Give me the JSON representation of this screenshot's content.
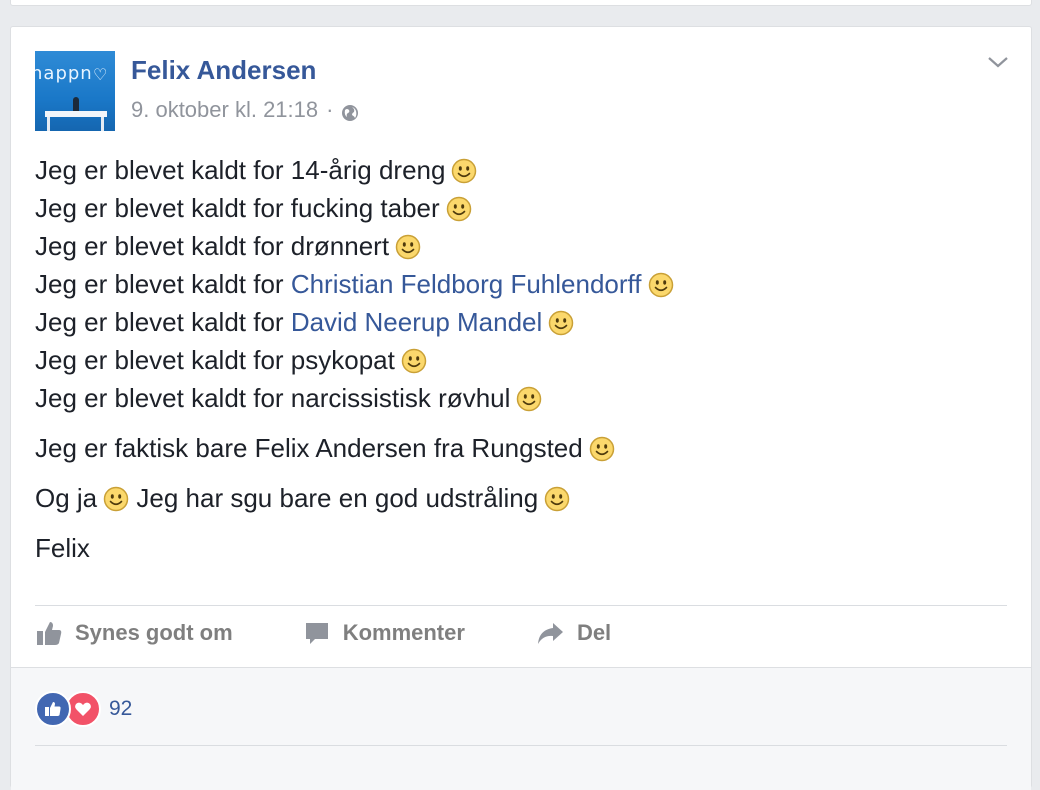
{
  "post": {
    "author": "Felix Andersen",
    "timestamp": "9. oktober kl. 21:18",
    "separator": "·",
    "privacy_icon": "globe-icon",
    "avatar_text": "happn",
    "lines": [
      {
        "prefix": "Jeg er blevet kaldt for 14-årig dreng",
        "link": ""
      },
      {
        "prefix": "Jeg er blevet kaldt for fucking taber",
        "link": ""
      },
      {
        "prefix": "Jeg er blevet kaldt for drønnert",
        "link": ""
      },
      {
        "prefix": "Jeg er blevet kaldt for ",
        "link": "Christian Feldborg Fuhlendorff"
      },
      {
        "prefix": "Jeg er blevet kaldt for ",
        "link": "David Neerup Mandel"
      },
      {
        "prefix": "Jeg er blevet kaldt for psykopat",
        "link": ""
      },
      {
        "prefix": "Jeg er blevet kaldt for narcissistisk røvhul",
        "link": ""
      }
    ],
    "para2": "Jeg er faktisk bare Felix Andersen fra Rungsted",
    "para3_a": "Og ja",
    "para3_b": "Jeg har sgu bare en god udstråling",
    "signature": "Felix"
  },
  "actions": {
    "like": "Synes godt om",
    "comment": "Kommenter",
    "share": "Del"
  },
  "reactions": {
    "count": "92",
    "types": [
      "like-icon",
      "love-icon"
    ],
    "like_color": "#4267b2",
    "love_color": "#f25268"
  },
  "colors": {
    "link": "#365899",
    "text": "#1d2129",
    "muted": "#90949c"
  }
}
